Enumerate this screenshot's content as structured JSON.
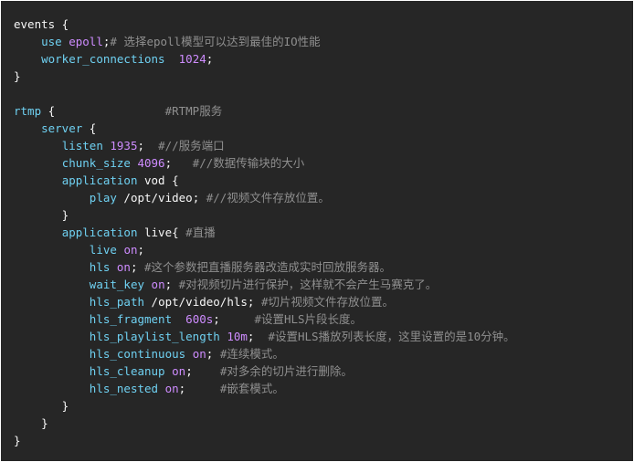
{
  "colors": {
    "background": "#262626",
    "directive": "#6fd1f2",
    "value": "#ce8cff",
    "comment": "#8f8f8f",
    "text": "#f7f7f7"
  },
  "code_lines": [
    [
      {
        "t": "events {",
        "c": "plain"
      }
    ],
    [
      {
        "t": "    ",
        "c": "plain"
      },
      {
        "t": "use",
        "c": "kw"
      },
      {
        "t": " ",
        "c": "plain"
      },
      {
        "t": "epoll",
        "c": "val"
      },
      {
        "t": ";",
        "c": "plain"
      },
      {
        "t": "# 选择epoll模型可以达到最佳的IO性能",
        "c": "cm"
      }
    ],
    [
      {
        "t": "    ",
        "c": "plain"
      },
      {
        "t": "worker_connections",
        "c": "kw"
      },
      {
        "t": "  ",
        "c": "plain"
      },
      {
        "t": "1024",
        "c": "val"
      },
      {
        "t": ";",
        "c": "plain"
      }
    ],
    [
      {
        "t": "}",
        "c": "plain"
      }
    ],
    [
      {
        "t": "",
        "c": "plain"
      }
    ],
    [
      {
        "t": "rtmp",
        "c": "kw"
      },
      {
        "t": " {                ",
        "c": "plain"
      },
      {
        "t": "#RTMP服务",
        "c": "cm"
      }
    ],
    [
      {
        "t": "    ",
        "c": "plain"
      },
      {
        "t": "server",
        "c": "kw"
      },
      {
        "t": " {",
        "c": "plain"
      }
    ],
    [
      {
        "t": "       ",
        "c": "plain"
      },
      {
        "t": "listen",
        "c": "kw"
      },
      {
        "t": " ",
        "c": "plain"
      },
      {
        "t": "1935",
        "c": "val"
      },
      {
        "t": ";  ",
        "c": "plain"
      },
      {
        "t": "#//服务端口",
        "c": "cm"
      }
    ],
    [
      {
        "t": "       ",
        "c": "plain"
      },
      {
        "t": "chunk_size",
        "c": "kw"
      },
      {
        "t": " ",
        "c": "plain"
      },
      {
        "t": "4096",
        "c": "val"
      },
      {
        "t": ";   ",
        "c": "plain"
      },
      {
        "t": "#//数据传输块的大小",
        "c": "cm"
      }
    ],
    [
      {
        "t": "       ",
        "c": "plain"
      },
      {
        "t": "application",
        "c": "kw"
      },
      {
        "t": " vod {",
        "c": "plain"
      }
    ],
    [
      {
        "t": "           ",
        "c": "plain"
      },
      {
        "t": "play",
        "c": "kw"
      },
      {
        "t": " /opt/video; ",
        "c": "plain"
      },
      {
        "t": "#//视频文件存放位置。",
        "c": "cm"
      }
    ],
    [
      {
        "t": "       }",
        "c": "plain"
      }
    ],
    [
      {
        "t": "       ",
        "c": "plain"
      },
      {
        "t": "application",
        "c": "kw"
      },
      {
        "t": " live{ ",
        "c": "plain"
      },
      {
        "t": "#直播",
        "c": "cm"
      }
    ],
    [
      {
        "t": "           ",
        "c": "plain"
      },
      {
        "t": "live",
        "c": "kw"
      },
      {
        "t": " ",
        "c": "plain"
      },
      {
        "t": "on",
        "c": "val"
      },
      {
        "t": ";",
        "c": "plain"
      }
    ],
    [
      {
        "t": "           ",
        "c": "plain"
      },
      {
        "t": "hls",
        "c": "kw"
      },
      {
        "t": " ",
        "c": "plain"
      },
      {
        "t": "on",
        "c": "val"
      },
      {
        "t": "; ",
        "c": "plain"
      },
      {
        "t": "#这个参数把直播服务器改造成实时回放服务器。",
        "c": "cm"
      }
    ],
    [
      {
        "t": "           ",
        "c": "plain"
      },
      {
        "t": "wait_key",
        "c": "kw"
      },
      {
        "t": " ",
        "c": "plain"
      },
      {
        "t": "on",
        "c": "val"
      },
      {
        "t": "; ",
        "c": "plain"
      },
      {
        "t": "#对视频切片进行保护，这样就不会产生马赛克了。",
        "c": "cm"
      }
    ],
    [
      {
        "t": "           ",
        "c": "plain"
      },
      {
        "t": "hls_path",
        "c": "kw"
      },
      {
        "t": " /opt/video/hls; ",
        "c": "plain"
      },
      {
        "t": "#切片视频文件存放位置。",
        "c": "cm"
      }
    ],
    [
      {
        "t": "           ",
        "c": "plain"
      },
      {
        "t": "hls_fragment",
        "c": "kw"
      },
      {
        "t": "  ",
        "c": "plain"
      },
      {
        "t": "600s",
        "c": "val"
      },
      {
        "t": ";     ",
        "c": "plain"
      },
      {
        "t": "#设置HLS片段长度。",
        "c": "cm"
      }
    ],
    [
      {
        "t": "           ",
        "c": "plain"
      },
      {
        "t": "hls_playlist_length",
        "c": "kw"
      },
      {
        "t": " ",
        "c": "plain"
      },
      {
        "t": "10m",
        "c": "val"
      },
      {
        "t": ";  ",
        "c": "plain"
      },
      {
        "t": "#设置HLS播放列表长度，这里设置的是10分钟。",
        "c": "cm"
      }
    ],
    [
      {
        "t": "           ",
        "c": "plain"
      },
      {
        "t": "hls_continuous",
        "c": "kw"
      },
      {
        "t": " ",
        "c": "plain"
      },
      {
        "t": "on",
        "c": "val"
      },
      {
        "t": "; ",
        "c": "plain"
      },
      {
        "t": "#连续模式。",
        "c": "cm"
      }
    ],
    [
      {
        "t": "           ",
        "c": "plain"
      },
      {
        "t": "hls_cleanup",
        "c": "kw"
      },
      {
        "t": " ",
        "c": "plain"
      },
      {
        "t": "on",
        "c": "val"
      },
      {
        "t": ";    ",
        "c": "plain"
      },
      {
        "t": "#对多余的切片进行删除。",
        "c": "cm"
      }
    ],
    [
      {
        "t": "           ",
        "c": "plain"
      },
      {
        "t": "hls_nested",
        "c": "kw"
      },
      {
        "t": " ",
        "c": "plain"
      },
      {
        "t": "on",
        "c": "val"
      },
      {
        "t": ";     ",
        "c": "plain"
      },
      {
        "t": "#嵌套模式。",
        "c": "cm"
      }
    ],
    [
      {
        "t": "       }",
        "c": "plain"
      }
    ],
    [
      {
        "t": "    }",
        "c": "plain"
      }
    ],
    [
      {
        "t": "}",
        "c": "plain"
      }
    ]
  ]
}
